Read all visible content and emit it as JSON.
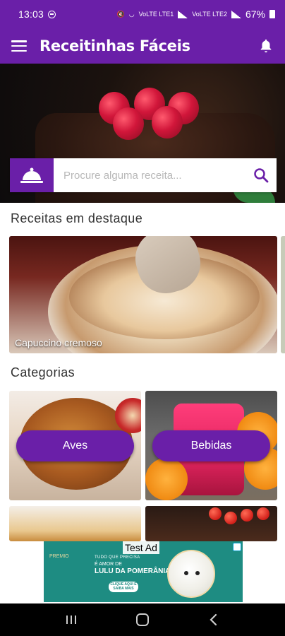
{
  "status_bar": {
    "time": "13:03",
    "network_1": "VoLTE LTE1",
    "network_2": "VoLTE LTE2",
    "battery": "67%"
  },
  "app_bar": {
    "title": "Receitinhas Fáceis",
    "menu_icon": "hamburger-menu-icon",
    "notification_icon": "bell-icon",
    "color": "#6a1fa8"
  },
  "search": {
    "placeholder": "Procure alguma receita...",
    "value": "",
    "left_icon": "cloche-icon",
    "right_icon": "search-icon",
    "icon_color": "#6a1fa8"
  },
  "featured": {
    "title": "Receitas em destaque",
    "items": [
      {
        "caption": "Capuccino cremoso"
      }
    ]
  },
  "categories": {
    "title": "Categorias",
    "items": [
      {
        "label": "Aves"
      },
      {
        "label": "Bebidas"
      }
    ]
  },
  "ad": {
    "label": "Test Ad",
    "brand": "PREMIO",
    "line1": "TUDO QUE PRECISA",
    "line2": "É AMOR DE",
    "headline": "LULU DA POMERÂNIA!",
    "cta": "CLIQUE AQUI E SAIBA MAIS"
  },
  "nav_bar": {
    "recents_icon": "recents-icon",
    "home_icon": "home-icon",
    "back_icon": "back-chevron-icon"
  }
}
